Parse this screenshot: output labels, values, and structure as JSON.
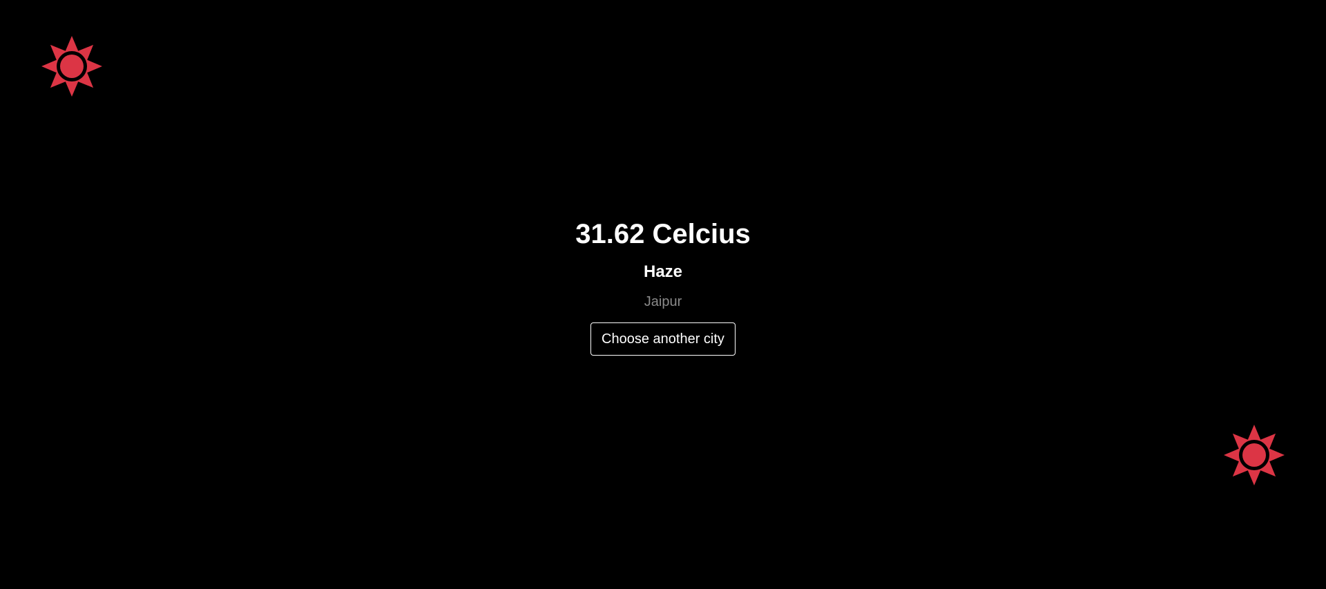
{
  "weather": {
    "temperature": "31.62 Celcius",
    "condition": "Haze",
    "city": "Jaipur"
  },
  "actions": {
    "choose_city_label": "Choose another city"
  },
  "decorations": {
    "icon": "sun-icon",
    "accent_color": "#dc3545"
  },
  "colors": {
    "background": "#000000",
    "text_primary": "#ffffff",
    "text_muted": "#8a8a8a",
    "button_border": "#ffffff"
  }
}
